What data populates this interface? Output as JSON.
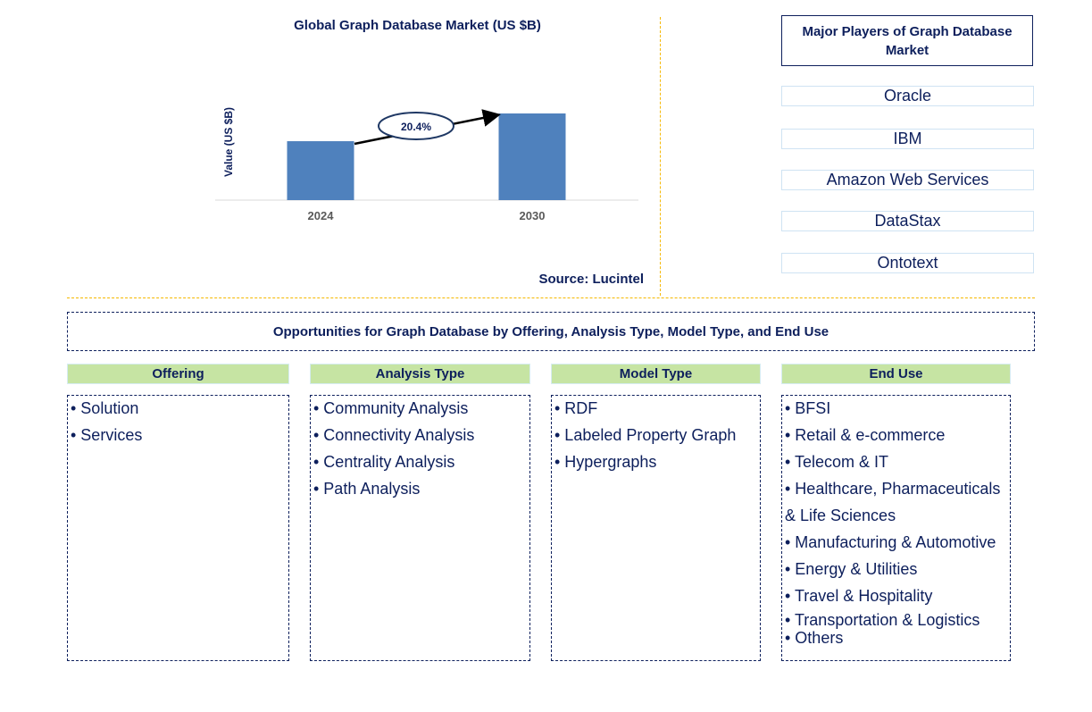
{
  "chart_data": {
    "type": "bar",
    "title": "Global Graph Database Market (US $B)",
    "xlabel": "",
    "ylabel": "Value (US $B)",
    "categories": [
      "2024",
      "2030"
    ],
    "values": [
      0.68,
      1.0
    ],
    "value_note": "No y-axis scale shown; values are relative bar heights",
    "annotation": {
      "label": "20.4%",
      "meaning": "CAGR 2024-2030",
      "from": "2024",
      "to": "2030"
    },
    "grid": false,
    "colors": {
      "bar": "#4f81bd",
      "text": "#0d1f5c",
      "axis_label": "#595959"
    },
    "source": "Source: Lucintel"
  },
  "players": {
    "title": "Major Players of Graph Database Market",
    "items": [
      "Oracle",
      "IBM",
      "Amazon Web Services",
      "DataStax",
      "Ontotext"
    ]
  },
  "opportunities": {
    "title": "Opportunities for Graph Database by Offering, Analysis Type, Model Type, and End Use",
    "categories": [
      {
        "name": "Offering",
        "items": [
          "• Solution",
          "• Services"
        ]
      },
      {
        "name": "Analysis Type",
        "items": [
          "• Community Analysis",
          "• Connectivity Analysis",
          "• Centrality Analysis",
          "• Path Analysis"
        ]
      },
      {
        "name": "Model Type",
        "items": [
          "• RDF",
          "• Labeled Property Graph",
          "• Hypergraphs"
        ]
      },
      {
        "name": "End Use",
        "items": [
          "• BFSI",
          "• Retail & e-commerce",
          "• Telecom & IT",
          "• Healthcare, Pharmaceuticals",
          " & Life Sciences",
          "• Manufacturing & Automotive",
          "• Energy & Utilities",
          "• Travel & Hospitality",
          "• Transportation & Logistics",
          "• Others"
        ]
      }
    ]
  }
}
